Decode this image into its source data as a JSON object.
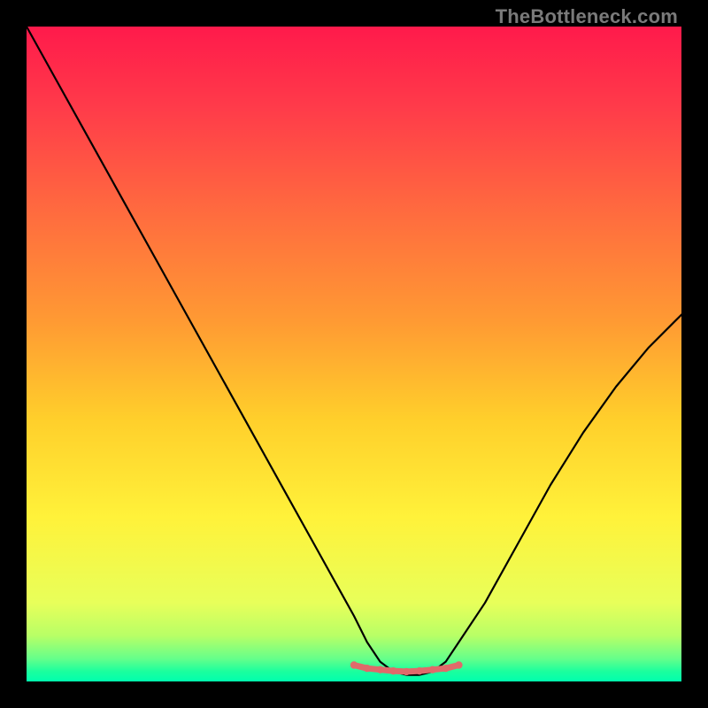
{
  "watermark": "TheBottleneck.com",
  "chart_data": {
    "type": "line",
    "title": "",
    "xlabel": "",
    "ylabel": "",
    "xlim": [
      0,
      100
    ],
    "ylim": [
      0,
      100
    ],
    "series": [
      {
        "name": "bottleneck-curve",
        "x": [
          0,
          5,
          10,
          15,
          20,
          25,
          30,
          35,
          40,
          45,
          50,
          52,
          54,
          56,
          58,
          60,
          62,
          64,
          66,
          70,
          75,
          80,
          85,
          90,
          95,
          100
        ],
        "values": [
          100,
          91,
          82,
          73,
          64,
          55,
          46,
          37,
          28,
          19,
          10,
          6,
          3,
          1.5,
          1,
          1,
          1.5,
          3,
          6,
          12,
          21,
          30,
          38,
          45,
          51,
          56
        ]
      },
      {
        "name": "bottom-highlight",
        "x": [
          50,
          52,
          54,
          56,
          58,
          60,
          62,
          64,
          66
        ],
        "values": [
          2.5,
          2.0,
          1.8,
          1.6,
          1.5,
          1.6,
          1.8,
          2.0,
          2.5
        ]
      }
    ],
    "gradient_stops": [
      {
        "pct": 0,
        "color": "#ff1a4b"
      },
      {
        "pct": 12,
        "color": "#ff3a4a"
      },
      {
        "pct": 28,
        "color": "#ff6a3f"
      },
      {
        "pct": 45,
        "color": "#ff9a33"
      },
      {
        "pct": 60,
        "color": "#ffcf2b"
      },
      {
        "pct": 75,
        "color": "#fff23a"
      },
      {
        "pct": 88,
        "color": "#e8ff5a"
      },
      {
        "pct": 93,
        "color": "#b8ff66"
      },
      {
        "pct": 96.5,
        "color": "#66ff8a"
      },
      {
        "pct": 98.5,
        "color": "#1aff9e"
      },
      {
        "pct": 100,
        "color": "#00ffae"
      }
    ],
    "highlight_color": "#e06a6a"
  }
}
